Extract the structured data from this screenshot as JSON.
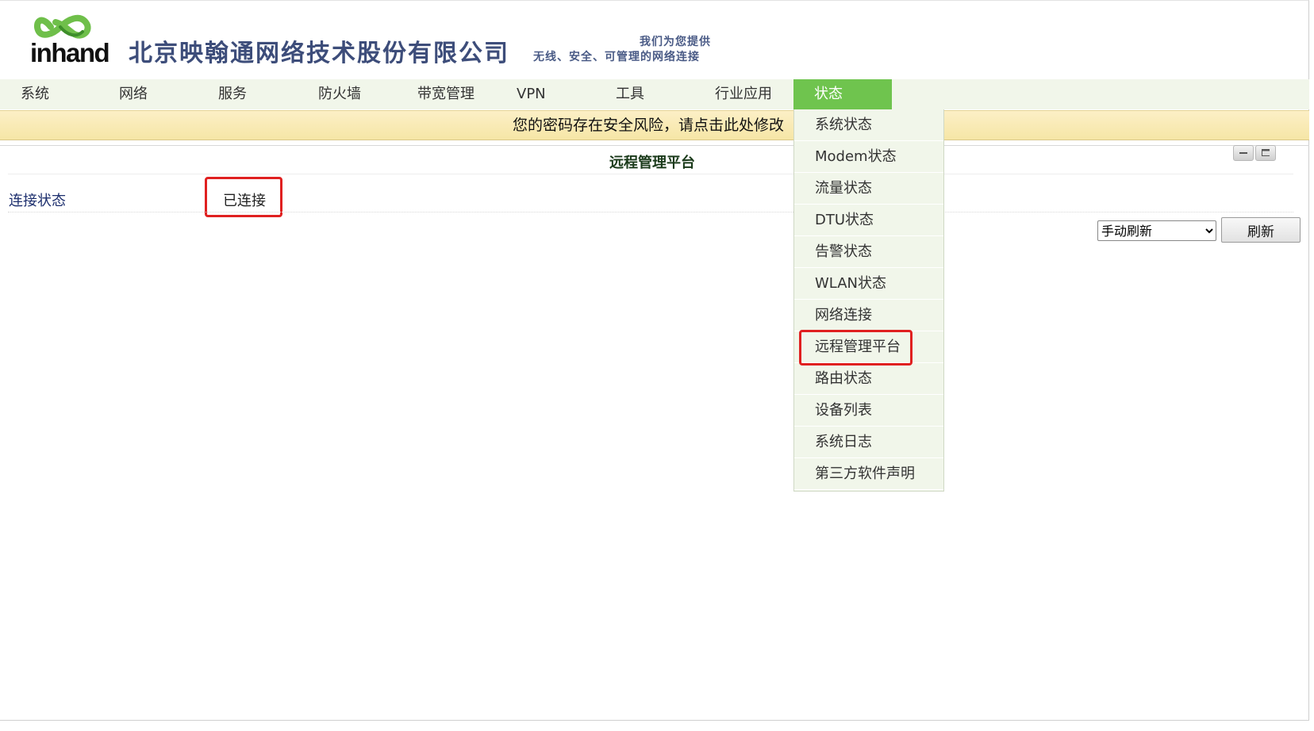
{
  "header": {
    "logo_text": "inhand",
    "company_name": "北京映翰通网络技术股份有限公司",
    "slogan_line1": "我们为您提供",
    "slogan_line2": "无线、安全、可管理的网络连接"
  },
  "nav": {
    "items": [
      {
        "label": "系统"
      },
      {
        "label": "网络"
      },
      {
        "label": "服务"
      },
      {
        "label": "防火墙"
      },
      {
        "label": "带宽管理"
      },
      {
        "label": "VPN"
      },
      {
        "label": "工具"
      },
      {
        "label": "行业应用"
      },
      {
        "label": "状态"
      }
    ],
    "active": "状态"
  },
  "warning": {
    "text": "您的密码存在安全风险，请点击此处修改"
  },
  "main": {
    "title": "远程管理平台",
    "rows": [
      {
        "label": "连接状态",
        "value": "已连接"
      }
    ],
    "refresh_select": {
      "selected": "手动刷新"
    },
    "refresh_button": "刷新"
  },
  "status_menu": {
    "items": [
      {
        "label": "系统状态"
      },
      {
        "label": "Modem状态"
      },
      {
        "label": "流量状态"
      },
      {
        "label": "DTU状态"
      },
      {
        "label": "告警状态"
      },
      {
        "label": "WLAN状态"
      },
      {
        "label": "网络连接"
      },
      {
        "label": "远程管理平台"
      },
      {
        "label": "路由状态"
      },
      {
        "label": "设备列表"
      },
      {
        "label": "系统日志"
      },
      {
        "label": "第三方软件声明"
      }
    ],
    "highlighted": "远程管理平台"
  },
  "colors": {
    "nav_active": "#6fc44e",
    "nav_bg": "#f1f6ea",
    "warning_bg": "#f8eab4",
    "highlight_border": "#e02020",
    "company_text": "#3d4d7a"
  }
}
